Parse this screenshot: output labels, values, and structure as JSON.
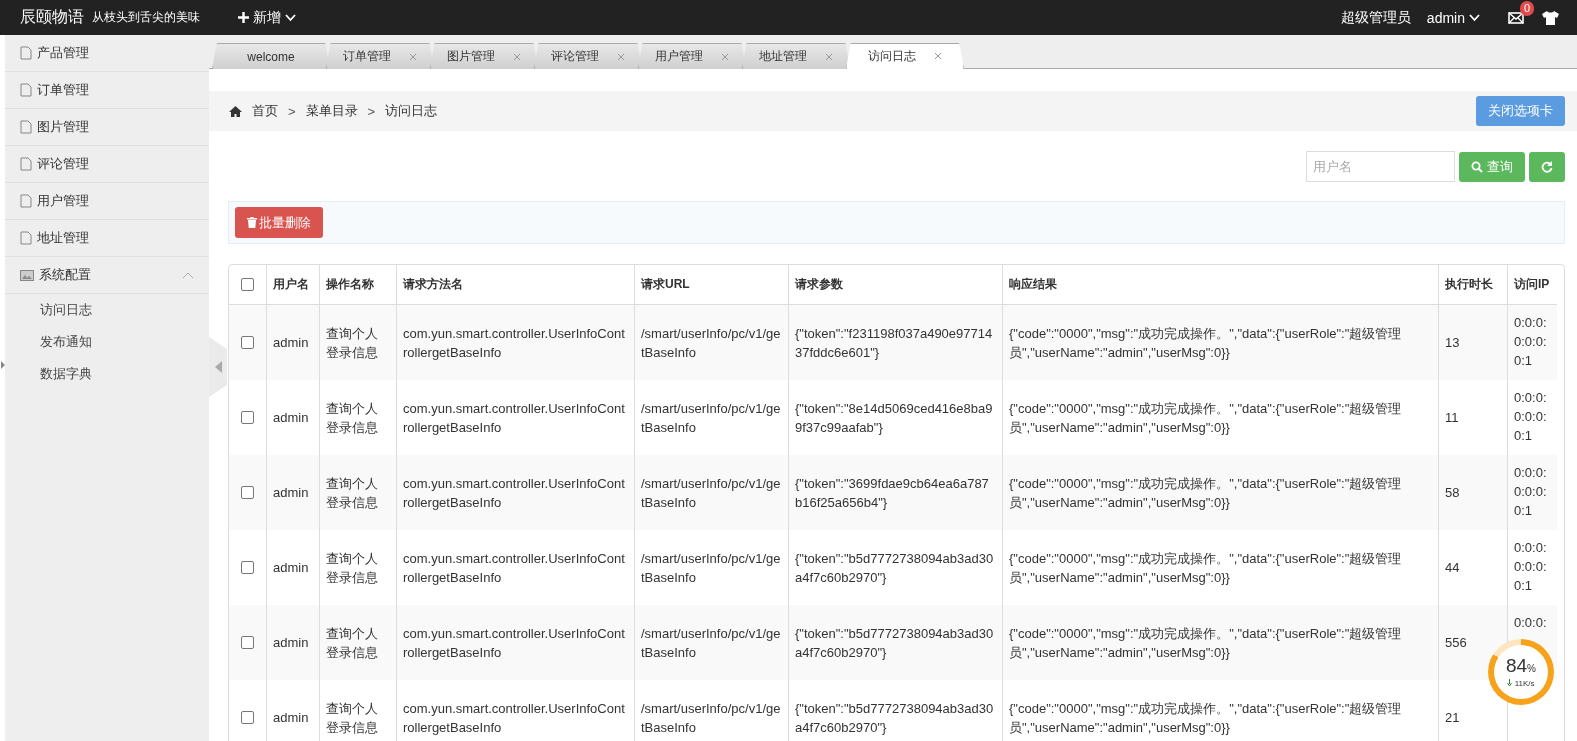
{
  "topbar": {
    "brand": "辰颐物语",
    "slogan": "从枝头到舌尖的美味",
    "add_menu": "新增",
    "role": "超级管理员",
    "user": "admin",
    "mail_badge": "0"
  },
  "sidebar": {
    "items": [
      {
        "label": "产品管理",
        "kind": "page"
      },
      {
        "label": "订单管理",
        "kind": "page"
      },
      {
        "label": "图片管理",
        "kind": "page"
      },
      {
        "label": "评论管理",
        "kind": "page"
      },
      {
        "label": "用户管理",
        "kind": "page"
      },
      {
        "label": "地址管理",
        "kind": "page"
      },
      {
        "label": "系统配置",
        "kind": "group",
        "expanded": true,
        "children": [
          {
            "label": "访问日志"
          },
          {
            "label": "发布通知"
          },
          {
            "label": "数据字典"
          }
        ]
      }
    ]
  },
  "tabs": [
    {
      "label": "welcome",
      "closable": false,
      "selected": false
    },
    {
      "label": "订单管理",
      "closable": true,
      "selected": false
    },
    {
      "label": "图片管理",
      "closable": true,
      "selected": false
    },
    {
      "label": "评论管理",
      "closable": true,
      "selected": false
    },
    {
      "label": "用户管理",
      "closable": true,
      "selected": false
    },
    {
      "label": "地址管理",
      "closable": true,
      "selected": false
    },
    {
      "label": "访问日志",
      "closable": true,
      "selected": true
    }
  ],
  "breadcrumb": [
    {
      "kind": "home",
      "label": "首页"
    },
    {
      "kind": "separator",
      "label": ">"
    },
    {
      "kind": "link",
      "label": "菜单目录"
    },
    {
      "kind": "separator",
      "label": ">"
    },
    {
      "kind": "current",
      "label": "访问日志"
    }
  ],
  "close_tabs_button": "关闭选项卡",
  "search": {
    "placeholder": "用户名",
    "button": "查询"
  },
  "batch_delete_button": "批量删除",
  "table": {
    "all_checked": false,
    "columns": [
      "用户名",
      "操作名称",
      "请求方法名",
      "请求URL",
      "请求参数",
      "响应结果",
      "执行时长",
      "访问IP"
    ],
    "rows": [
      {
        "checked": false,
        "cells": [
          "admin",
          "查询个人登录信息",
          "com.yun.smart.controller.UserInfoControllergetBaseInfo",
          "/smart/userInfo/pc/v1/getBaseInfo",
          "{\"token\":\"f231198f037a490e9771437fddc6e601\"}",
          "{\"code\":\"0000\",\"msg\":\"成功完成操作。\",\"data\":{\"userRole\":\"超级管理员\",\"userName\":\"admin\",\"userMsg\":0}}",
          "13",
          "0:0:0:0:0:0:0:1"
        ]
      },
      {
        "checked": false,
        "cells": [
          "admin",
          "查询个人登录信息",
          "com.yun.smart.controller.UserInfoControllergetBaseInfo",
          "/smart/userInfo/pc/v1/getBaseInfo",
          "{\"token\":\"8e14d5069ced416e8ba99f37c99aafab\"}",
          "{\"code\":\"0000\",\"msg\":\"成功完成操作。\",\"data\":{\"userRole\":\"超级管理员\",\"userName\":\"admin\",\"userMsg\":0}}",
          "11",
          "0:0:0:0:0:0:0:1"
        ]
      },
      {
        "checked": false,
        "cells": [
          "admin",
          "查询个人登录信息",
          "com.yun.smart.controller.UserInfoControllergetBaseInfo",
          "/smart/userInfo/pc/v1/getBaseInfo",
          "{\"token\":\"3699fdae9cb64ea6a787b16f25a656b4\"}",
          "{\"code\":\"0000\",\"msg\":\"成功完成操作。\",\"data\":{\"userRole\":\"超级管理员\",\"userName\":\"admin\",\"userMsg\":0}}",
          "58",
          "0:0:0:0:0:0:0:1"
        ]
      },
      {
        "checked": false,
        "cells": [
          "admin",
          "查询个人登录信息",
          "com.yun.smart.controller.UserInfoControllergetBaseInfo",
          "/smart/userInfo/pc/v1/getBaseInfo",
          "{\"token\":\"b5d7772738094ab3ad30a4f7c60b2970\"}",
          "{\"code\":\"0000\",\"msg\":\"成功完成操作。\",\"data\":{\"userRole\":\"超级管理员\",\"userName\":\"admin\",\"userMsg\":0}}",
          "44",
          "0:0:0:0:0:0:0:1"
        ]
      },
      {
        "checked": false,
        "cells": [
          "admin",
          "查询个人登录信息",
          "com.yun.smart.controller.UserInfoControllergetBaseInfo",
          "/smart/userInfo/pc/v1/getBaseInfo",
          "{\"token\":\"b5d7772738094ab3ad30a4f7c60b2970\"}",
          "{\"code\":\"0000\",\"msg\":\"成功完成操作。\",\"data\":{\"userRole\":\"超级管理员\",\"userName\":\"admin\",\"userMsg\":0}}",
          "556",
          "0:0:0:"
        ]
      },
      {
        "checked": false,
        "cells": [
          "admin",
          "查询个人登录信息",
          "com.yun.smart.controller.UserInfoControllergetBaseInfo",
          "/smart/userInfo/pc/v1/getBaseInfo",
          "{\"token\":\"b5d7772738094ab3ad30a4f7c60b2970\"}",
          "{\"code\":\"0000\",\"msg\":\"成功完成操作。\",\"data\":{\"userRole\":\"超级管理员\",\"userName\":\"admin\",\"userMsg\":0}}",
          "21",
          ""
        ]
      }
    ]
  },
  "speed_widget": {
    "percent": "84",
    "unit": "%",
    "rate": "11K/s",
    "level": 0.84
  }
}
